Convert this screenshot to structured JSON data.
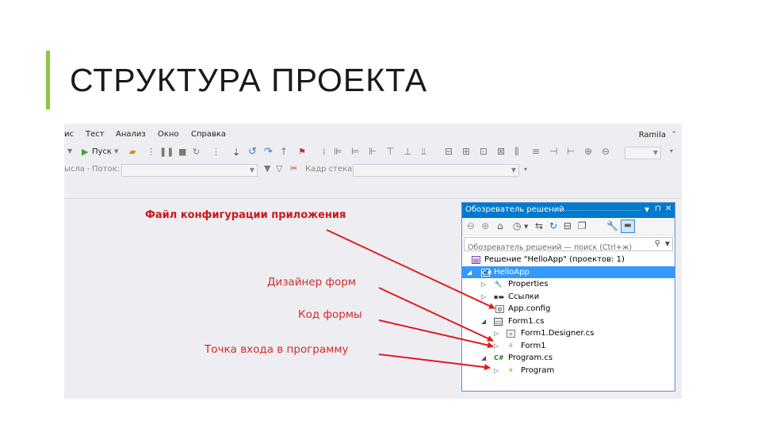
{
  "slide": {
    "title": "СТРУКТУРА ПРОЕКТА",
    "accent_color": "#8dc63f"
  },
  "ide": {
    "menu": [
      "ис",
      "Тест",
      "Анализ",
      "Окно",
      "Справка"
    ],
    "account": "Ramila",
    "toolbar": {
      "run_label": "Пуск",
      "thread_left_label": "ысла -",
      "thread_label": "Поток:",
      "stack_label": "Кадр стека:"
    },
    "icons": {
      "run": "play-icon",
      "expand": "triangle-icon",
      "pin": "pin-icon",
      "close": "close-icon",
      "back": "back-arrow-icon",
      "forward": "forward-arrow-icon",
      "home": "home-icon",
      "history": "history-icon",
      "sync": "sync-icon",
      "refresh": "refresh-icon",
      "properties": "wrench-icon",
      "preview": "preview-icon",
      "search": "search-icon"
    }
  },
  "annotations": {
    "config": "Файл конфигурации приложения",
    "designer": "Дизайнер форм",
    "code": "Код формы",
    "entry": "Точка входа в программу",
    "arrow_color": "#e01b1b"
  },
  "solution_explorer": {
    "title": "Обозреватель решений",
    "search_placeholder": "Обозреватель решений — поиск (Ctrl+ж)",
    "tree": [
      {
        "label": "Решение \"HelloApp\"  (проектов: 1)",
        "icon": "solution-icon",
        "expander": ""
      },
      {
        "label": "HelloApp",
        "icon": "csharp-project-icon",
        "expander": "◢",
        "selected": true
      },
      {
        "label": "Properties",
        "icon": "wrench-icon",
        "expander": "▷"
      },
      {
        "label": "Ссылки",
        "icon": "references-icon",
        "expander": "▷"
      },
      {
        "label": "App.config",
        "icon": "config-file-icon",
        "expander": ""
      },
      {
        "label": "Form1.cs",
        "icon": "form-icon",
        "expander": "◢"
      },
      {
        "label": "Form1.Designer.cs",
        "icon": "designer-file-icon",
        "expander": "▷"
      },
      {
        "label": "Form1",
        "icon": "class-icon",
        "expander": "▷"
      },
      {
        "label": "Program.cs",
        "icon": "csharp-file-icon",
        "expander": "◢"
      },
      {
        "label": "Program",
        "icon": "class-icon",
        "expander": "▷"
      }
    ]
  }
}
